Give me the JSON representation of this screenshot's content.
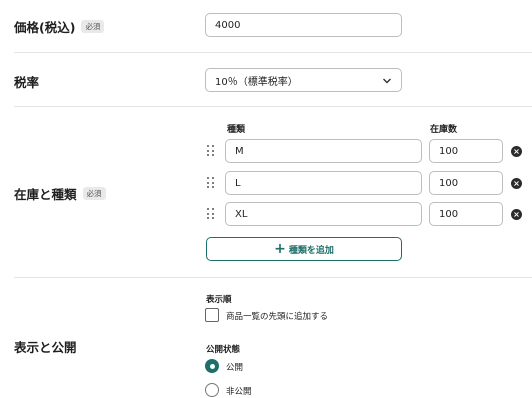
{
  "price": {
    "label": "価格(税込)",
    "required_badge": "必須",
    "value": "4000"
  },
  "tax": {
    "label": "税率",
    "selected": "10％（標準税率）"
  },
  "stock": {
    "label": "在庫と種類",
    "required_badge": "必須",
    "col_type": "種類",
    "col_stock": "在庫数",
    "rows": [
      {
        "type": "M",
        "stock": "100"
      },
      {
        "type": "L",
        "stock": "100"
      },
      {
        "type": "XL",
        "stock": "100"
      }
    ],
    "add_label": "種類を追加"
  },
  "visibility": {
    "label": "表示と公開",
    "display_order_label": "表示順",
    "add_to_top_label": "商品一覧の先頭に追加する",
    "add_to_top_checked": false,
    "status_label": "公開状態",
    "options": [
      {
        "label": "公開",
        "checked": true
      },
      {
        "label": "非公開",
        "checked": false
      }
    ]
  }
}
